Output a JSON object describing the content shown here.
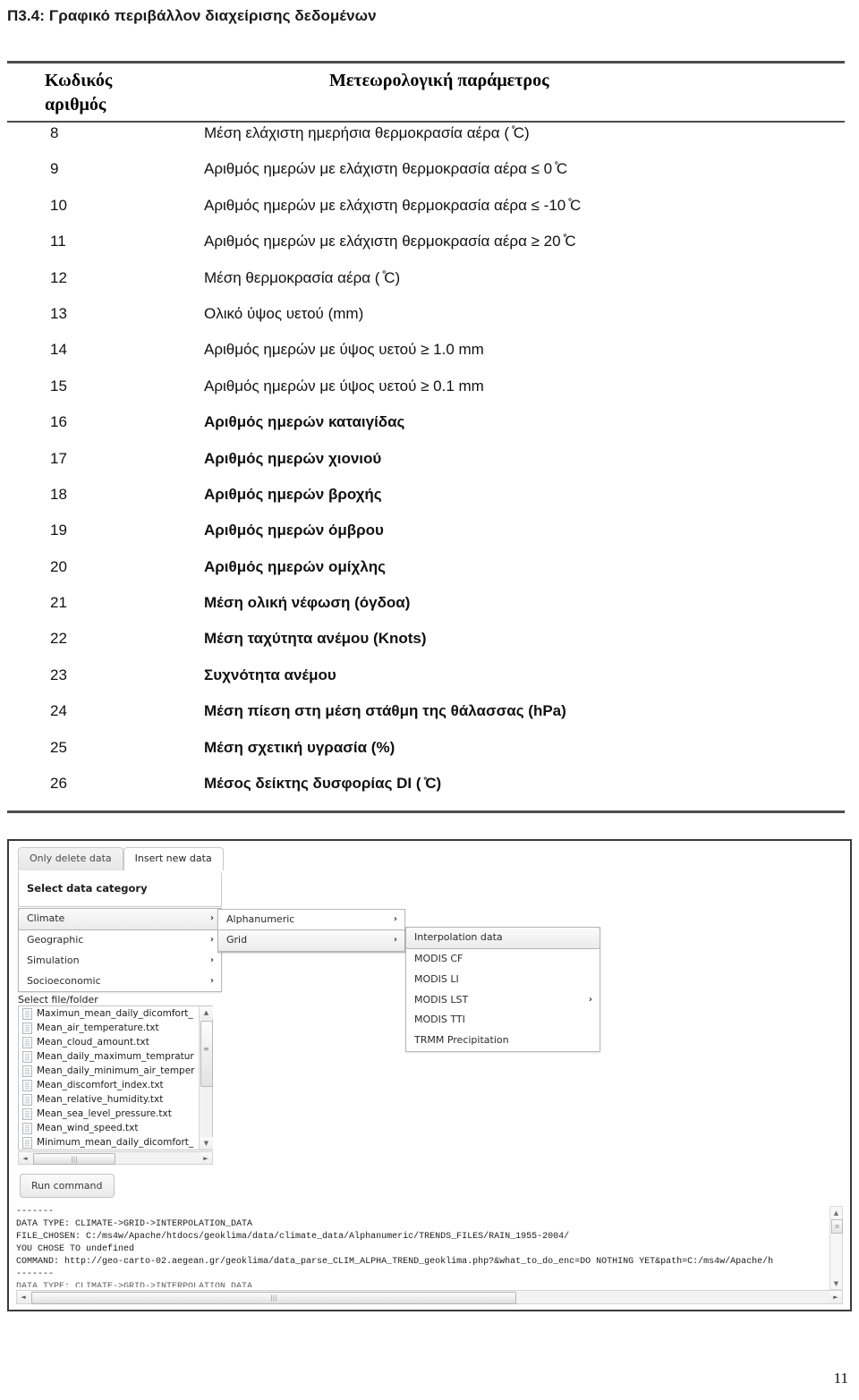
{
  "document": {
    "heading": "Π3.4: Γραφικό περιβάλλον διαχείρισης δεδομένων",
    "page_number": "11"
  },
  "table": {
    "headers": {
      "code": "Κωδικός",
      "code_line2": "αριθμός",
      "parameter": "Μετεωρολογική παράμετρος"
    },
    "rows": [
      {
        "code": "8",
        "parameter": "Μέση ελάχιστη ημερήσια θερμοκρασία αέρα ( ̊C)"
      },
      {
        "code": "9",
        "parameter": "Αριθμός ημερών με ελάχιστη θερμοκρασία αέρα ≤ 0 ̊C"
      },
      {
        "code": "10",
        "parameter": "Αριθμός ημερών με ελάχιστη θερμοκρασία αέρα ≤ -10 ̊C"
      },
      {
        "code": "11",
        "parameter": "Αριθμός ημερών με ελάχιστη θερμοκρασία αέρα ≥ 20 ̊C"
      },
      {
        "code": "12",
        "parameter": "Μέση θερμοκρασία αέρα ( ̊C)"
      },
      {
        "code": "13",
        "parameter": "Ολικό ύψος υετού (mm)"
      },
      {
        "code": "14",
        "parameter": "Αριθμός ημερών με ύψος υετού ≥  1.0 mm"
      },
      {
        "code": "15",
        "parameter": "Αριθμός ημερών με ύψος υετού ≥  0.1 mm"
      },
      {
        "code": "16",
        "parameter": "Αριθμός ημερών καταιγίδας"
      },
      {
        "code": "17",
        "parameter": "Αριθμός ημερών χιονιού"
      },
      {
        "code": "18",
        "parameter": "Αριθμός ημερών βροχής"
      },
      {
        "code": "19",
        "parameter": "Αριθμός ημερών όμβρου"
      },
      {
        "code": "20",
        "parameter": "Αριθμός ημερών ομίχλης"
      },
      {
        "code": "21",
        "parameter": "Μέση ολική νέφωση (όγδοα)"
      },
      {
        "code": "22",
        "parameter": "Μέση ταχύτητα ανέμου (Knots)"
      },
      {
        "code": "23",
        "parameter": "Συχνότητα ανέμου"
      },
      {
        "code": "24",
        "parameter": "Μέση πίεση στη μέση στάθμη της θάλασσας (hPa)"
      },
      {
        "code": "25",
        "parameter": "Μέση σχετική υγρασία (%)"
      },
      {
        "code": "26",
        "parameter": "Μέσος δείκτης δυσφορίας DI ( ̊C)"
      }
    ]
  },
  "app": {
    "tabs": [
      {
        "label": "Only delete data",
        "active": false
      },
      {
        "label": "Insert new data",
        "active": true
      }
    ],
    "panel_title": "Select data category",
    "menu_level1": [
      {
        "label": "Climate",
        "arrow": "›",
        "selected": true
      },
      {
        "label": "Geographic",
        "arrow": "›",
        "selected": false
      },
      {
        "label": "Simulation",
        "arrow": "›",
        "selected": false
      },
      {
        "label": "Socioeconomic",
        "arrow": "›",
        "selected": false
      }
    ],
    "menu_level2": [
      {
        "label": "Alphanumeric",
        "arrow": "›",
        "selected": false
      },
      {
        "label": "Grid",
        "arrow": "›",
        "selected": true
      }
    ],
    "menu_level3": [
      {
        "label": "Interpolation data",
        "arrow": "",
        "selected": true
      },
      {
        "label": "MODIS CF",
        "arrow": "",
        "selected": false
      },
      {
        "label": "MODIS LI",
        "arrow": "",
        "selected": false
      },
      {
        "label": "MODIS LST",
        "arrow": "›",
        "selected": false
      },
      {
        "label": "MODIS TTI",
        "arrow": "",
        "selected": false
      },
      {
        "label": "TRMM Precipitation",
        "arrow": "",
        "selected": false
      }
    ],
    "file_section_label": "Select file/folder",
    "files": [
      "Maximun_mean_daily_dicomfort_",
      "Mean_air_temperature.txt",
      "Mean_cloud_amount.txt",
      "Mean_daily_maximum_tempratur",
      "Mean_daily_minimum_air_temper",
      "Mean_discomfort_index.txt",
      "Mean_relative_humidity.txt",
      "Mean_sea_level_pressure.txt",
      "Mean_wind_speed.txt",
      "Minimum_mean_daily_dicomfort_"
    ],
    "run_button": "Run command",
    "scroll_glyphs": {
      "up": "▲",
      "down": "▼",
      "left": "◄",
      "right": "►",
      "grip": "|||"
    },
    "console_lines": [
      "-------",
      "DATA TYPE: CLIMATE->GRID->INTERPOLATION_DATA",
      "FILE_CHOSEN: C:/ms4w/Apache/htdocs/geoklima/data/climate_data/Alphanumeric/TRENDS_FILES/RAIN_1955-2004/",
      "YOU CHOSE TO undefined",
      "COMMAND: http://geo-carto-02.aegean.gr/geoklima/data_parse_CLIM_ALPHA_TREND_geoklima.php?&what_to_do_enc=DO NOTHING YET&path=C:/ms4w/Apache/h",
      "-------"
    ],
    "console_clipped_line": "DATA TYPE: CLIMATE->GRID->INTERPOLATION_DATA"
  }
}
